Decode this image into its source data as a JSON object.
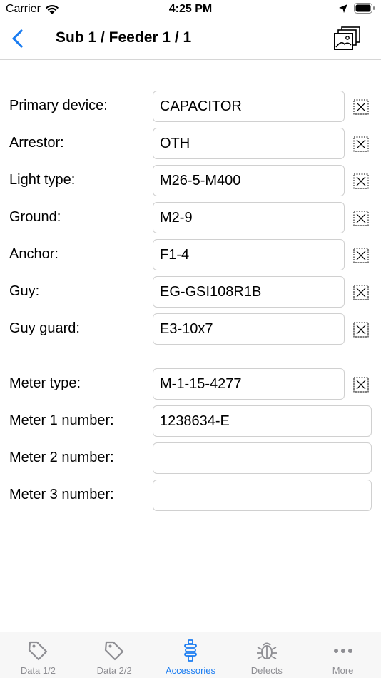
{
  "status": {
    "carrier": "Carrier",
    "time": "4:25 PM"
  },
  "nav": {
    "title": "Sub 1 / Feeder 1 / 1"
  },
  "fields_group1": [
    {
      "label": "Primary device:",
      "value": "CAPACITOR",
      "clearable": true
    },
    {
      "label": "Arrestor:",
      "value": "OTH",
      "clearable": true
    },
    {
      "label": "Light type:",
      "value": "M26-5-M400",
      "clearable": true
    },
    {
      "label": "Ground:",
      "value": "M2-9",
      "clearable": true
    },
    {
      "label": "Anchor:",
      "value": "F1-4",
      "clearable": true
    },
    {
      "label": "Guy:",
      "value": "EG-GSI108R1B",
      "clearable": true
    },
    {
      "label": "Guy guard:",
      "value": "E3-10x7",
      "clearable": true
    }
  ],
  "fields_group2": [
    {
      "label": "Meter type:",
      "value": "M-1-15-4277",
      "clearable": true
    },
    {
      "label": "Meter 1 number:",
      "value": "1238634-E",
      "clearable": false
    },
    {
      "label": "Meter 2 number:",
      "value": "",
      "clearable": false
    },
    {
      "label": "Meter 3 number:",
      "value": "",
      "clearable": false
    }
  ],
  "tabs": [
    {
      "label": "Data 1/2",
      "icon": "tag-icon",
      "active": false
    },
    {
      "label": "Data 2/2",
      "icon": "tag-icon",
      "active": false
    },
    {
      "label": "Accessories",
      "icon": "insulator-icon",
      "active": true
    },
    {
      "label": "Defects",
      "icon": "bug-icon",
      "active": false
    },
    {
      "label": "More",
      "icon": "more-icon",
      "active": false
    }
  ],
  "colors": {
    "accent": "#1a7cf1",
    "inactive": "#8e8e93"
  }
}
